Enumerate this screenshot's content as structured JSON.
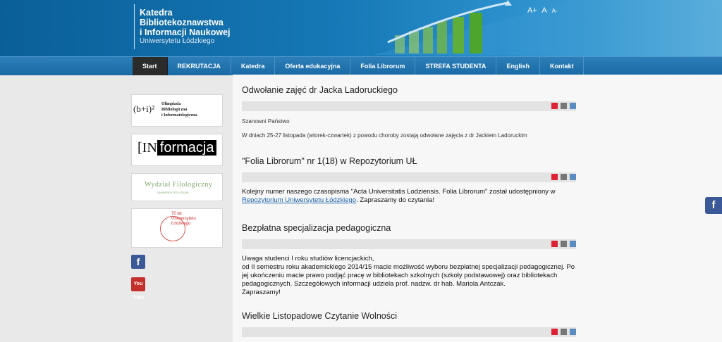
{
  "header": {
    "title_line1": "Katedra",
    "title_line2": "Bibliotekoznawstwa",
    "title_line3": "i Informacji Naukowej",
    "subtitle": "Uniwersytetu Łódzkiego",
    "font_size_controls": [
      "A+",
      "A",
      "A-"
    ]
  },
  "nav": {
    "items": [
      "Start",
      "REKRUTACJA",
      "Katedra",
      "Oferta edukacyjna",
      "Folia Librorum",
      "STREFA STUDENTA",
      "English",
      "Kontakt"
    ]
  },
  "sidebar": {
    "olimpiada_symbol": "(b+i)²",
    "olimpiada_lines": [
      "Olimpiada",
      "Bibliologiczna",
      "i Informatologiczna"
    ],
    "informacja_bracket": "[IN",
    "informacja_word": "formacja",
    "wydzial": "Wydział Filologiczny",
    "wydzial_sub": "UNIWERSYTET ŁÓDZKI",
    "anniversary_lines": [
      "70 lat",
      "Uniwersytetu",
      "Łódzkiego"
    ],
    "facebook_icon": "f",
    "youtube_icon": "You Tube"
  },
  "articles": [
    {
      "title": "Odwołanie zajęć dr Jacka Ladoruckiego",
      "greeting": "Szanowni Państwo",
      "body": "W dniach 25-27 listopada (wtorek-czwartek) z powodu choroby zostają odwołane zajęcia z dr Jackiem Ladoruckim"
    },
    {
      "title": "\"Folia Librorum\" nr 1(18) w Repozytorium UŁ",
      "body_start": "Kolejny numer naszego czasopisma \"Acta Universitatis Lodziensis. Folia Librorum\" został udostępniony w",
      "link": "Repozytorium Uniwersytetu Łódzkiego",
      "body_end": ". Zapraszamy do czytania!"
    },
    {
      "title": "Bezpłatna specjalizacja pedagogiczna",
      "lines": [
        "Uwaga studenci I roku studiów licencjackich,",
        "od II semestru roku akademickiego 2014/15 macie możliwość wyboru bezpłatnej specjalizacji pedagogicznej. Po",
        "jej ukończeniu macie prawo podjąć pracę w bibliotekach szkolnych (szkoły podstawowej) oraz bibliotekach",
        "pedagogicznych. Szczegółowych informacji udziela prof. nadzw. dr hab. Mariola Antczak.",
        "Zapraszamy!"
      ]
    },
    {
      "title": "Wielkie Listopadowe Czytanie Wolności"
    }
  ],
  "icons": {
    "pdf": "pdf-icon",
    "print": "print-icon",
    "email": "email-icon"
  }
}
